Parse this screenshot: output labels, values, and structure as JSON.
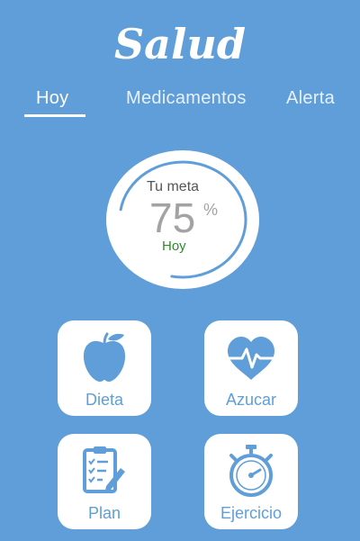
{
  "app": {
    "title": "Salud"
  },
  "tabs": [
    {
      "label": "Hoy",
      "active": true
    },
    {
      "label": "Medicamentos",
      "active": false
    },
    {
      "label": "Alerta",
      "active": false
    }
  ],
  "goal": {
    "label": "Tu meta",
    "value": "75",
    "unit": "%",
    "day": "Hoy",
    "progress_percent": 75
  },
  "tiles": [
    {
      "label": "Dieta",
      "icon": "apple-icon"
    },
    {
      "label": "Azucar",
      "icon": "heart-pulse-icon"
    },
    {
      "label": "Plan",
      "icon": "clipboard-checklist-icon"
    },
    {
      "label": "Ejercicio",
      "icon": "stopwatch-icon"
    }
  ],
  "colors": {
    "background": "#5f9ed8",
    "surface": "#ffffff",
    "accent": "#5f9ed8",
    "goal_day": "#2f8a2f",
    "goal_value": "#a3a3a3"
  }
}
